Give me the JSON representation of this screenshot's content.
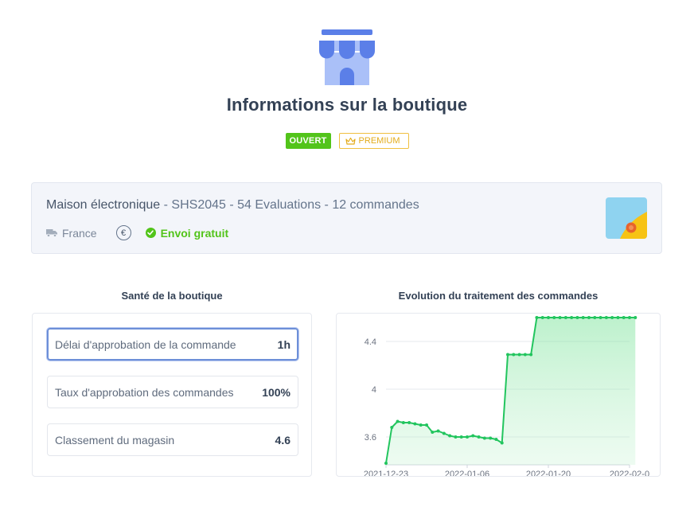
{
  "header": {
    "icon": "storefront-icon",
    "title": "Informations sur la boutique",
    "status_badge": "OUVERT",
    "premium_badge": "PREMIUM",
    "colors": {
      "open": "#52c41a",
      "premium": "#e3ac1b",
      "icon_blue": "#5b7fe8"
    }
  },
  "shop_info": {
    "name": "Maison électronique",
    "details": " - SHS2045 - 54 Evaluations - 12 commandes",
    "country": "France",
    "currency_symbol": "€",
    "shipping": "Envoi gratuit"
  },
  "health": {
    "title": "Santé de la boutique",
    "metrics": [
      {
        "label": "Délai d'approbation de la commande",
        "value": "1h"
      },
      {
        "label": "Taux d'approbation des commandes",
        "value": "100%"
      },
      {
        "label": "Classement du magasin",
        "value": "4.6"
      }
    ]
  },
  "chart": {
    "title": "Evolution du traitement des commandes"
  },
  "chart_data": {
    "type": "area",
    "title": "Evolution du traitement des commandes",
    "xlabel": "",
    "ylabel": "",
    "x_ticks": [
      "2021-12-23",
      "2022-01-06",
      "2022-01-20",
      "2022-02-0"
    ],
    "y_ticks": [
      3.6,
      4,
      4.4
    ],
    "grid": true,
    "color": "#22c55e",
    "series": [
      {
        "x": [
          "2021-12-23",
          "2021-12-24",
          "2021-12-25",
          "2021-12-26",
          "2021-12-27",
          "2021-12-28",
          "2021-12-29",
          "2021-12-30",
          "2021-12-31",
          "2022-01-01",
          "2022-01-02",
          "2022-01-03",
          "2022-01-04",
          "2022-01-05",
          "2022-01-06",
          "2022-01-07",
          "2022-01-08",
          "2022-01-09",
          "2022-01-10",
          "2022-01-11",
          "2022-01-12",
          "2022-01-13",
          "2022-01-14",
          "2022-01-15",
          "2022-01-16",
          "2022-01-17",
          "2022-01-18",
          "2022-01-19",
          "2022-01-20",
          "2022-01-21",
          "2022-01-22",
          "2022-01-23",
          "2022-01-24",
          "2022-01-25",
          "2022-01-26",
          "2022-01-27",
          "2022-01-28",
          "2022-01-29",
          "2022-01-30",
          "2022-01-31",
          "2022-02-01",
          "2022-02-02",
          "2022-02-03",
          "2022-02-04"
        ],
        "values": [
          3.38,
          3.68,
          3.73,
          3.72,
          3.72,
          3.71,
          3.7,
          3.7,
          3.64,
          3.65,
          3.63,
          3.61,
          3.6,
          3.6,
          3.6,
          3.61,
          3.6,
          3.59,
          3.59,
          3.58,
          3.55,
          4.29,
          4.29,
          4.29,
          4.29,
          4.29,
          4.6,
          4.6,
          4.6,
          4.6,
          4.6,
          4.6,
          4.6,
          4.6,
          4.6,
          4.6,
          4.6,
          4.6,
          4.6,
          4.6,
          4.6,
          4.6,
          4.6,
          4.6
        ]
      }
    ]
  }
}
